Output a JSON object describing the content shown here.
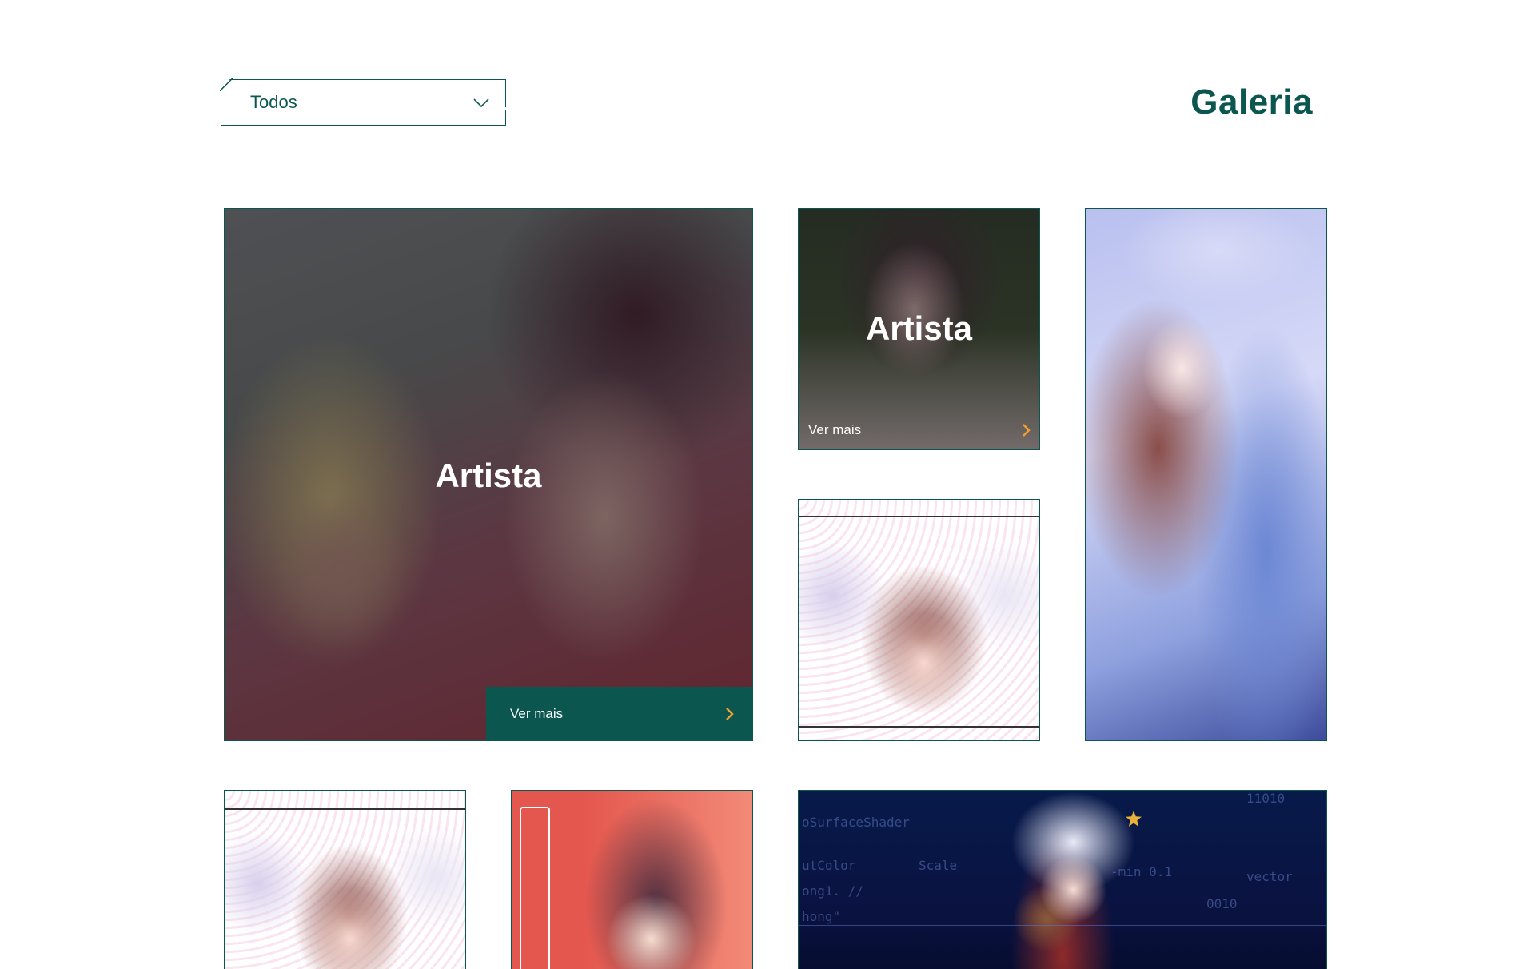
{
  "filter": {
    "selected": "Todos",
    "icon": "chevron-down-icon"
  },
  "page": {
    "title": "Galeria"
  },
  "gallery": {
    "tile_large": {
      "title": "Artista",
      "more_label": "Ver mais",
      "icon": "chevron-right-icon"
    },
    "tile_small_top": {
      "title": "Artista",
      "more_label": "Ver mais",
      "icon": "chevron-right-icon"
    },
    "tile_code_text": [
      "oSurfaceShader",
      "utColor",
      "ong1. //",
      "hong\"",
      "Scale",
      "-min 0.1",
      "vector",
      "0010",
      "11010"
    ]
  },
  "colors": {
    "brand": "#0b5750",
    "accent": "#f2a12e"
  }
}
